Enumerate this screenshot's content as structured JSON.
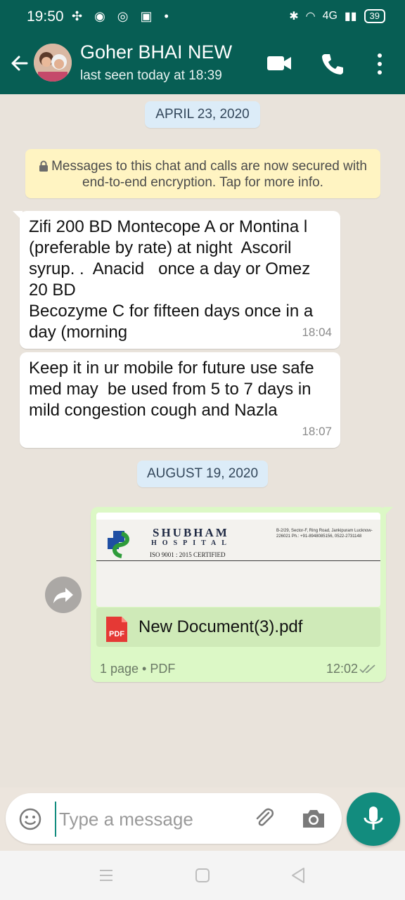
{
  "status_bar": {
    "time": "19:50",
    "battery": "39",
    "network": "4G"
  },
  "header": {
    "contact_name": "Goher BHAI NEW",
    "last_seen": "last seen today at 18:39"
  },
  "chat": {
    "date_1": "APRIL 23, 2020",
    "encryption_notice": "Messages to this chat and calls are now secured with end-to-end encryption. Tap for more info.",
    "messages": [
      {
        "text": "Zifi 200 BD Montecope A or Montina l (preferable by rate) at night  Ascoril syrup. .  Anacid   once a day or Omez 20 BD\nBecozyme C for fifteen days once in a day (morning",
        "time": "18:04"
      },
      {
        "text": "Keep it in ur mobile for future use safe med may  be used from 5 to 7 days in mild congestion cough and Nazla",
        "time": "18:07"
      }
    ],
    "date_2": "AUGUST 19, 2020",
    "document": {
      "preview": {
        "hospital_name": "SHUBHAM",
        "hospital_sub": "HOSPITAL",
        "certification": "ISO 9001 : 2015 CERTIFIED",
        "address": "B-2/29, Sector-F, Ring Road, Jankipuram Lucknow-226021 Ph.: +91-8948085156, 0522-2731148"
      },
      "file_name": "New Document(3).pdf",
      "file_icon_label": "PDF",
      "meta": "1 page • PDF",
      "time": "12:02"
    }
  },
  "input": {
    "placeholder": "Type a message"
  },
  "colors": {
    "header": "#075e54",
    "accent": "#128c7e",
    "outgoing_bubble": "#dcf8c6",
    "incoming_bubble": "#ffffff"
  }
}
